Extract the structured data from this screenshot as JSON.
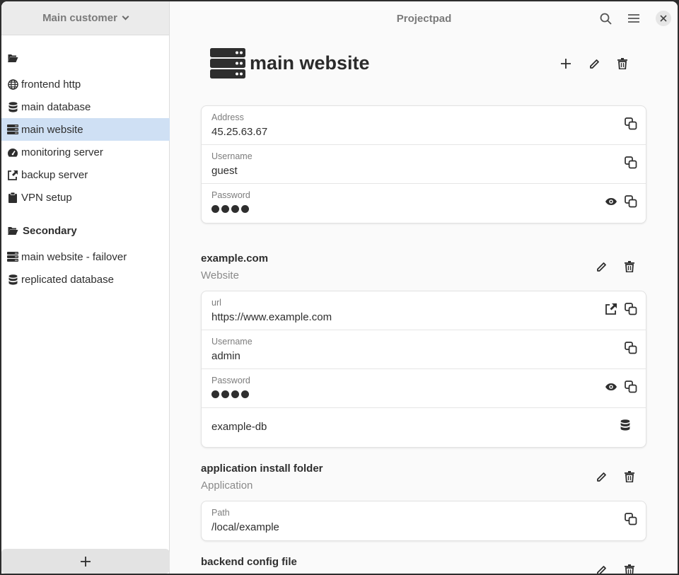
{
  "sidebar": {
    "customer": "Main customer",
    "groups": [
      {
        "label": ""
      },
      {
        "label": "Secondary"
      }
    ],
    "items": [
      {
        "label": "frontend http",
        "icon": "globe-icon"
      },
      {
        "label": "main database",
        "icon": "database-icon"
      },
      {
        "label": "main website",
        "icon": "server-icon",
        "active": true
      },
      {
        "label": "monitoring server",
        "icon": "gauge-icon"
      },
      {
        "label": "backup server",
        "icon": "share-icon"
      },
      {
        "label": "VPN setup",
        "icon": "clipboard-icon"
      },
      {
        "label": "main website - failover",
        "icon": "server-icon"
      },
      {
        "label": "replicated database",
        "icon": "database-icon"
      }
    ],
    "add_label": "+"
  },
  "topbar": {
    "title": "Projectpad"
  },
  "server": {
    "title": "main website",
    "fields": [
      {
        "label": "Address",
        "value": "45.25.63.67"
      },
      {
        "label": "Username",
        "value": "guest"
      },
      {
        "label": "Password",
        "value": "",
        "masked": true
      }
    ]
  },
  "sections": [
    {
      "title": "example.com",
      "subtitle": "Website",
      "fields": [
        {
          "label": "url",
          "value": "https://www.example.com"
        },
        {
          "label": "Username",
          "value": "admin"
        },
        {
          "label": "Password",
          "value": "",
          "masked": true
        },
        {
          "label": "",
          "value": "example-db"
        }
      ]
    },
    {
      "title": "application install folder",
      "subtitle": "Application",
      "fields": [
        {
          "label": "Path",
          "value": "/local/example"
        }
      ]
    },
    {
      "title": "backend config file",
      "subtitle": "",
      "fields": []
    }
  ],
  "colors": {
    "accent_selection": "#cfe0f4",
    "text": "#2e2e2e",
    "muted": "#7d7d7d"
  }
}
